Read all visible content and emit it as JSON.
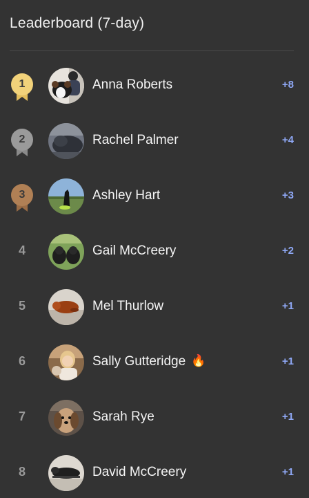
{
  "header": {
    "title": "Leaderboard (7-day)"
  },
  "colors": {
    "background": "#333333",
    "score": "#8fa8f5",
    "gold": "#f2d27a",
    "silver": "#9a9a9a",
    "bronze": "#b08055"
  },
  "entries": [
    {
      "rank": "1",
      "name": "Anna Roberts",
      "score": "+8",
      "badge": "gold-medal-icon"
    },
    {
      "rank": "2",
      "name": "Rachel Palmer",
      "score": "+4",
      "badge": "silver-medal-icon"
    },
    {
      "rank": "3",
      "name": "Ashley Hart",
      "score": "+3",
      "badge": "bronze-medal-icon"
    },
    {
      "rank": "4",
      "name": "Gail McCreery",
      "score": "+2"
    },
    {
      "rank": "5",
      "name": "Mel Thurlow",
      "score": "+1"
    },
    {
      "rank": "6",
      "name": "Sally Gutteridge",
      "score": "+1",
      "status_icon": "fire-icon"
    },
    {
      "rank": "7",
      "name": "Sarah Rye",
      "score": "+1"
    },
    {
      "rank": "8",
      "name": "David McCreery",
      "score": "+1"
    }
  ]
}
